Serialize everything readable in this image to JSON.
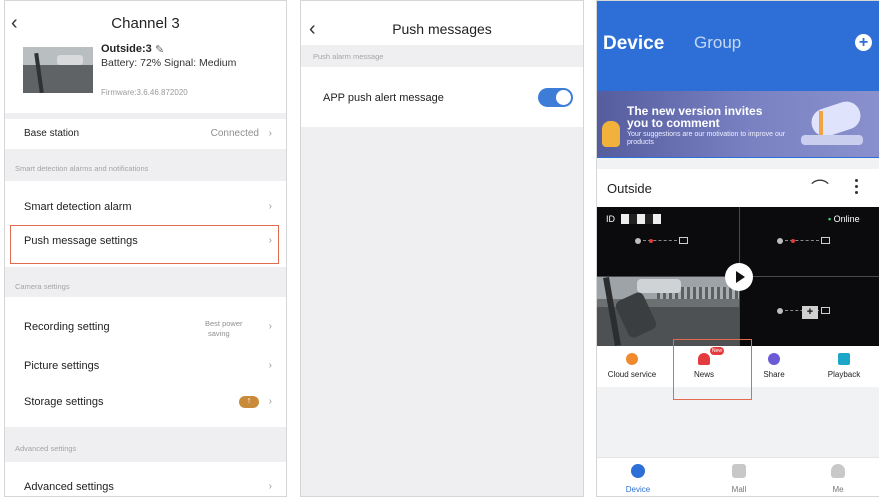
{
  "channel_panel": {
    "title": "Channel 3",
    "device": {
      "name": "Outside:3",
      "status_line": "Battery: 72% Signal: Medium",
      "firmware": "Firmware:3.6.46.872020"
    },
    "base_station": {
      "label": "Base station",
      "value": "Connected"
    },
    "section_smart": "Smart detection alarms and notifications",
    "smart_detection": "Smart detection alarm",
    "push_settings": "Push message settings",
    "section_camera": "Camera settings",
    "recording": {
      "label": "Recording setting",
      "value_line1": "Best power",
      "value_line2": "saving"
    },
    "picture": "Picture settings",
    "storage": "Storage settings",
    "section_advanced": "Advanced settings",
    "advanced": "Advanced settings"
  },
  "push_panel": {
    "title": "Push messages",
    "section": "Push alarm message",
    "toggle_label": "APP push alert message",
    "toggle_on": true
  },
  "device_panel": {
    "tabs": {
      "device": "Device",
      "group": "Group"
    },
    "banner": {
      "headline": "The new version invites you to comment",
      "sub": "Your suggestions are our motivation to improve our products"
    },
    "camera_card": {
      "title": "Outside",
      "id_prefix": "ID",
      "online": "Online"
    },
    "actions": [
      {
        "label": "Cloud service",
        "icon": "cloud-icon",
        "color": "#f08a2c"
      },
      {
        "label": "News",
        "icon": "news-icon",
        "color": "#e43c3c",
        "badge": "New"
      },
      {
        "label": "Share",
        "icon": "share-icon",
        "color": "#6b5bd6"
      },
      {
        "label": "Playback",
        "icon": "playback-icon",
        "color": "#1ca7c9"
      }
    ],
    "bottom_nav": [
      {
        "label": "Device",
        "icon": "device-icon",
        "active": true
      },
      {
        "label": "Mall",
        "icon": "mall-icon",
        "active": false
      },
      {
        "label": "Me",
        "icon": "me-icon",
        "active": false
      }
    ]
  },
  "colors": {
    "accent_blue": "#2d6fd6",
    "highlight_red": "#e16b4c",
    "toggle_on": "#3d7dd8"
  }
}
